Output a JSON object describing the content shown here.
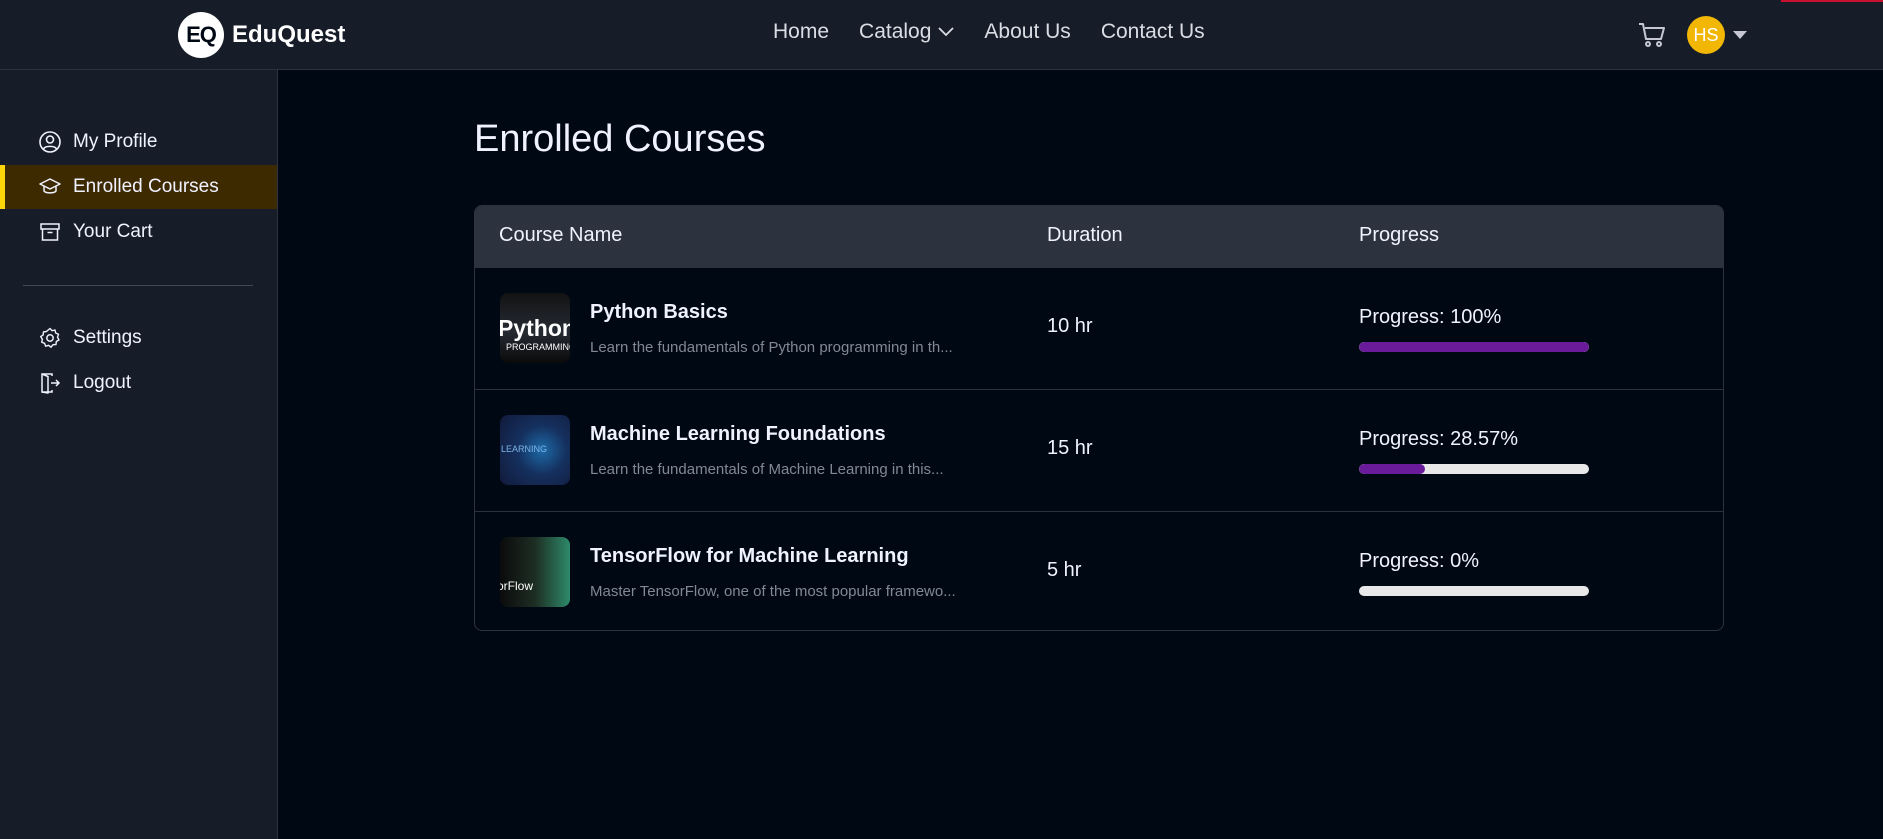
{
  "brand": {
    "logo_mark": "EQ",
    "name": "EduQuest"
  },
  "nav": {
    "home": "Home",
    "catalog": "Catalog",
    "about": "About Us",
    "contact": "Contact Us"
  },
  "header": {
    "cart_icon": "cart-icon",
    "avatar_initials": "HS",
    "avatar_color": "#f2b705"
  },
  "sidebar": {
    "items": [
      {
        "label": "My Profile",
        "icon": "user-circle-icon"
      },
      {
        "label": "Enrolled Courses",
        "icon": "graduation-cap-icon"
      },
      {
        "label": "Your Cart",
        "icon": "archive-box-icon"
      },
      {
        "label": "Settings",
        "icon": "gear-icon"
      },
      {
        "label": "Logout",
        "icon": "logout-icon"
      }
    ],
    "active_index": 1,
    "accent": "#ffd60a"
  },
  "main": {
    "title": "Enrolled Courses",
    "columns": [
      "Course Name",
      "Duration",
      "Progress"
    ],
    "courses": [
      {
        "name": "Python Basics",
        "description": "Learn the fundamentals of Python programming in th...",
        "duration": "10 hr",
        "progress_label": "Progress: 100%",
        "progress": 100,
        "thumb_text": [
          "Python",
          "PROGRAMMING"
        ]
      },
      {
        "name": "Machine Learning Foundations",
        "description": "Learn the fundamentals of Machine Learning in this...",
        "duration": "15 hr",
        "progress_label": "Progress: 28.57%",
        "progress": 28.57,
        "thumb_text": [
          "LEARNING"
        ]
      },
      {
        "name": "TensorFlow for Machine Learning",
        "description": "Master TensorFlow, one of the most popular framewo...",
        "duration": "5 hr",
        "progress_label": "Progress: 0%",
        "progress": 0,
        "thumb_text": [
          "orFlow"
        ]
      }
    ],
    "progress_color": "#6a1b9a"
  }
}
